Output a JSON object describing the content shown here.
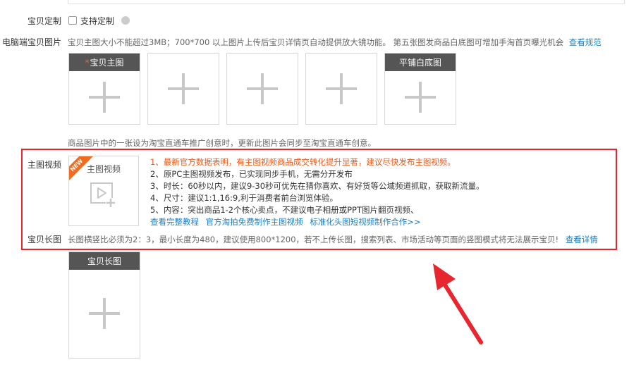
{
  "custom": {
    "label": "宝贝定制",
    "checkbox_label": "支持定制"
  },
  "pc_images": {
    "label": "电脑端宝贝图片",
    "hint_text": "宝贝主图大小不能超过3MB；700*700 以上图片上传后宝贝详情页自动提供放大镜功能。 第五张图发商品白底图可增加手淘首页曝光机会",
    "hint_link": "查看规范",
    "slots": [
      {
        "title": "宝贝主图",
        "required_mark": "*"
      },
      {
        "title": ""
      },
      {
        "title": ""
      },
      {
        "title": ""
      },
      {
        "title": "平铺白底图"
      }
    ],
    "footnote": "商品图片中的一张设为淘宝直通车推广创意时，更新此图片会同步至淘宝直通车创意。"
  },
  "main_video": {
    "label": "主图视频",
    "box_title": "主图视频",
    "badge": "NEW",
    "lines": [
      "1、最新官方数据表明，有主图视频商品成交转化提升显著，建议尽快发布主图视频。",
      "2、原PC主图视频发布，已实现同步手机，无需分开发布",
      "3、时长：60秒以内，建议9-30秒可优先在猜你喜欢、有好货等公域频道抓取，获取新流量。",
      "4、尺寸：建议1:1,16:9,利于消费者前台浏览体验。",
      "5、内容：突出商品1-2个核心卖点，不建议电子相册或PPT图片翻页视频、"
    ],
    "links": [
      "查看完整教程",
      "官方淘拍免费制作主图视频",
      "标准化头图短视频制作合作>>"
    ]
  },
  "long_image": {
    "label": "宝贝长图",
    "hint_text": "长图横竖比必须为2：3，最小长度为480，建议使用800*1200，若不上传长图，搜索列表、市场活动等页面的竖图模式将无法展示宝贝!",
    "hint_link": "查看详情",
    "slot_title": "宝贝长图"
  },
  "colors": {
    "highlight_border": "#e8262f",
    "arrow": "#e8262f",
    "link": "#1a7dc4",
    "orange_text": "#ef5a1a"
  }
}
